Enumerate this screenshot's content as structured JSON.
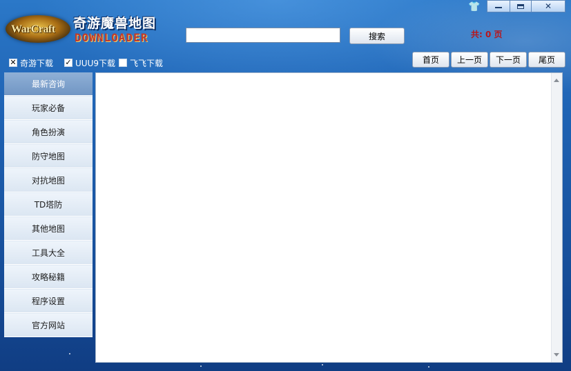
{
  "app": {
    "logo_text": "WarCraft",
    "title_cn": "奇游魔兽地图",
    "title_en": "DOWNLOADER"
  },
  "search": {
    "value": "",
    "placeholder": "",
    "button_label": "搜索"
  },
  "page_count": "共: 0 页",
  "window_controls": {
    "skin_icon": "shirt-icon",
    "minimize_icon": "minimize-icon",
    "maximize_icon": "maximize-icon",
    "close_label": "✕"
  },
  "sources": [
    {
      "label": "奇游下载",
      "checked": true,
      "mark": "✕"
    },
    {
      "label": "UUU9下载",
      "checked": true,
      "mark": "✓"
    },
    {
      "label": "飞飞下载",
      "checked": false,
      "mark": ""
    }
  ],
  "paging": {
    "first": "首页",
    "prev": "上一页",
    "next": "下一页",
    "last": "尾页"
  },
  "sidebar": {
    "items": [
      {
        "label": "最新咨询",
        "active": true
      },
      {
        "label": "玩家必备",
        "active": false
      },
      {
        "label": "角色扮演",
        "active": false
      },
      {
        "label": "防守地图",
        "active": false
      },
      {
        "label": "对抗地图",
        "active": false
      },
      {
        "label": "TD塔防",
        "active": false
      },
      {
        "label": "其他地图",
        "active": false
      },
      {
        "label": "工具大全",
        "active": false
      },
      {
        "label": "攻略秘籍",
        "active": false
      },
      {
        "label": "程序设置",
        "active": false
      },
      {
        "label": "官方网站",
        "active": false
      }
    ]
  },
  "colors": {
    "page_count": "#b8151a",
    "active_nav": "#7196c4",
    "background": "#1f63b4"
  }
}
